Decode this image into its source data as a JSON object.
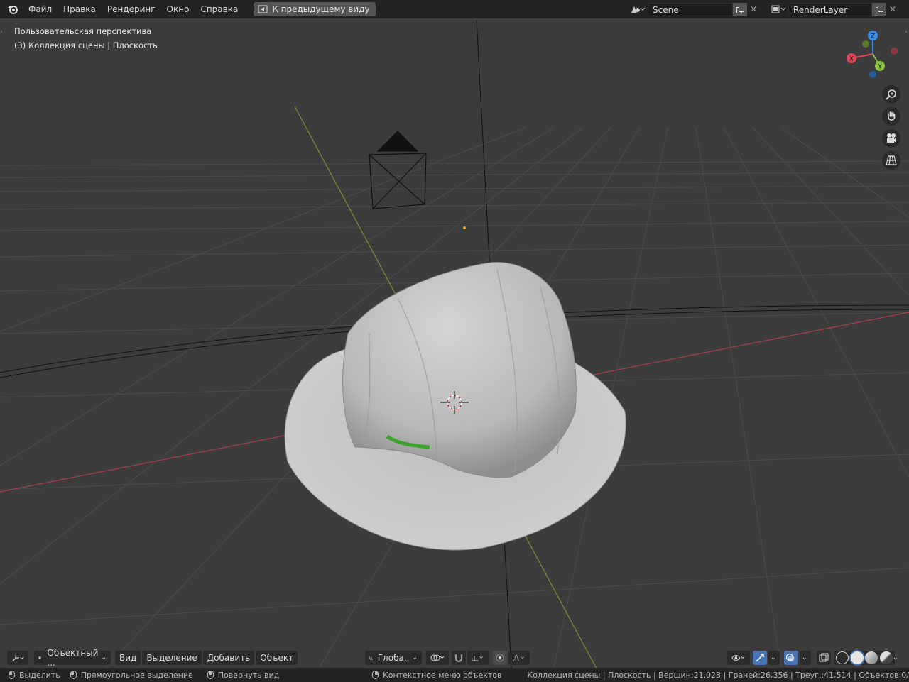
{
  "topbar": {
    "menus": [
      "Файл",
      "Правка",
      "Рендеринг",
      "Окно",
      "Справка"
    ],
    "back_button": "К предыдущему виду",
    "scene_name": "Scene",
    "render_layer": "RenderLayer"
  },
  "viewport": {
    "view_name": "Пользовательская перспектива",
    "collection_info": "(3) Коллекция сцены | Плоскость",
    "gizmo_axes": [
      "Z",
      "X",
      "Y"
    ],
    "axis_colors": {
      "x": "#e0485a",
      "y": "#8bc140",
      "z": "#3b8ee8"
    }
  },
  "header_bottom": {
    "mode": "Объектный ...",
    "menus": [
      "Вид",
      "Выделение",
      "Добавить",
      "Объект"
    ],
    "orientation": "Глоба.."
  },
  "statusbar": {
    "select": "Выделить",
    "box_select": "Прямоугольное выделение",
    "rotate_view": "Повернуть вид",
    "context_menu": "Контекстное меню объектов",
    "stats": "Коллекция сцены | Плоскость | Вершин:21,023 | Граней:26,356 | Треуг.:41,514 | Объектов:0/"
  }
}
